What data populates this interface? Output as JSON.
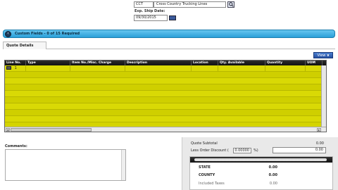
{
  "header": {
    "vendor_code": "CCT",
    "vendor_name": "Cross Country Trucking Lines",
    "exp_label": "Exp. Ship Date:",
    "exp_date": "09/30/2015"
  },
  "custom_fields": {
    "label": "Custom Fields - 0 of 15 Required"
  },
  "tabs": [
    {
      "label": "Quote Details"
    }
  ],
  "view_button": {
    "label": "View"
  },
  "grid": {
    "columns": [
      "Line No.",
      "Type",
      "Item No./Misc. Charge",
      "Description",
      "Location",
      "Qty. Available",
      "Quantity",
      "UOM"
    ],
    "first_row_line_no": "1"
  },
  "comments": {
    "label": "Comments:"
  },
  "summary": {
    "subtotal_label": "Quote Subtotal",
    "subtotal_value": "0.00",
    "discount_label": "Less Order Discount (",
    "discount_percent": "0.00000",
    "discount_pct_symbol": "%)",
    "discount_value": "0.00",
    "state_label": "STATE",
    "state_value": "0.00",
    "county_label": "COUNTY",
    "county_value": "0.00",
    "included_taxes_label": "Included Taxes",
    "included_taxes_value": "0.00"
  },
  "colors": {
    "grid_row": "#d9d905",
    "custom_bar": "#2a9fd8",
    "header_dark": "#111111"
  }
}
